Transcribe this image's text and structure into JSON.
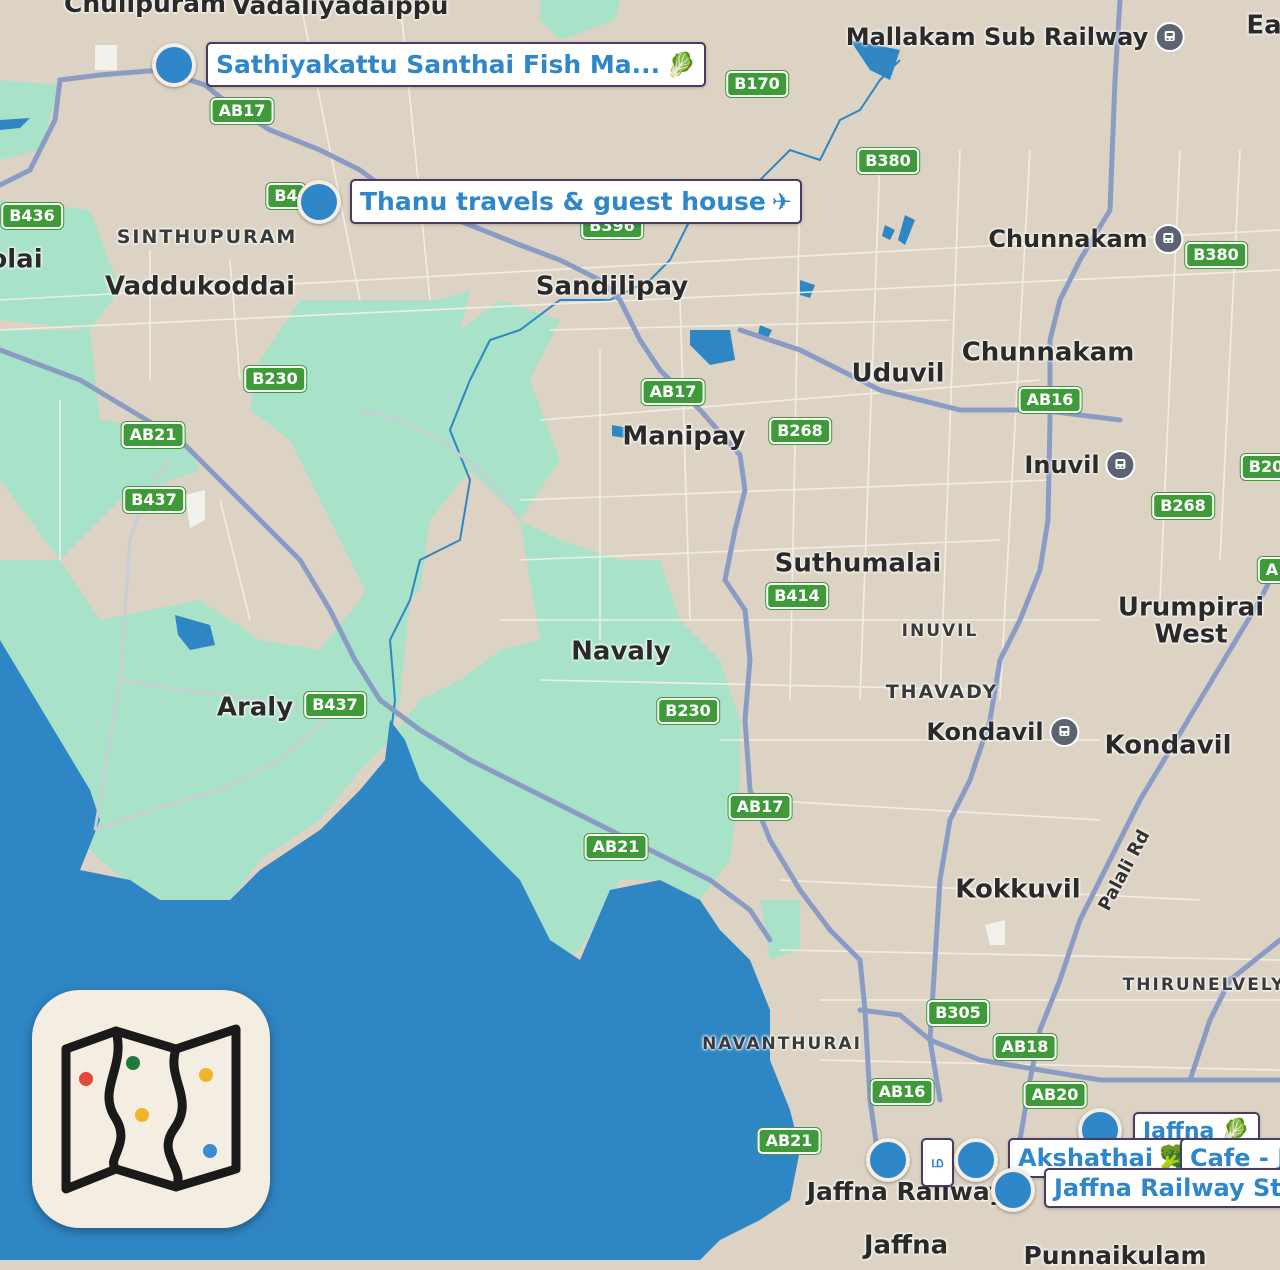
{
  "map": {
    "colors": {
      "land": "#dcd3c4",
      "water": "#2f86c4",
      "green": "#a8e2c8",
      "major_road": "#8b9cc4",
      "minor_road": "#f5f0e8",
      "route_shield": "#3f9a3a",
      "pin": "#2f86c9"
    },
    "places": [
      {
        "id": "chulipuram",
        "label": "Chulipuram"
      },
      {
        "id": "vadaliyadaippu",
        "label": "Vadaliyadaippu"
      },
      {
        "id": "sinthupuram",
        "label": "SINTHUPURAM"
      },
      {
        "id": "vaddukoddai",
        "label": "Vaddukoddai"
      },
      {
        "id": "olai",
        "label": "olai"
      },
      {
        "id": "sandilipay",
        "label": "Sandilipay"
      },
      {
        "id": "uduvil",
        "label": "Uduvil"
      },
      {
        "id": "chunnakam",
        "label": "Chunnakam"
      },
      {
        "id": "manipay",
        "label": "Manipay"
      },
      {
        "id": "suthumalai",
        "label": "Suthumalai"
      },
      {
        "id": "navaly",
        "label": "Navaly"
      },
      {
        "id": "inuvil_caps",
        "label": "INUVIL"
      },
      {
        "id": "urumpirai_west",
        "label": "Urumpirai West"
      },
      {
        "id": "thavady",
        "label": "THAVADY"
      },
      {
        "id": "kondavil",
        "label": "Kondavil"
      },
      {
        "id": "araly",
        "label": "Araly"
      },
      {
        "id": "kokkuvil",
        "label": "Kokkuvil"
      },
      {
        "id": "thirunelvely",
        "label": "THIRUNELVELY"
      },
      {
        "id": "navanthurai",
        "label": "NAVANTHURAI"
      },
      {
        "id": "jaffna",
        "label": "Jaffna"
      },
      {
        "id": "jaffna_railway_label",
        "label": "Jaffna Railway"
      },
      {
        "id": "ea",
        "label": "Ea"
      },
      {
        "id": "punnaikulam",
        "label": "Punnaikulam"
      }
    ],
    "rail_stations": [
      {
        "id": "mallakam",
        "label": "Mallakam Sub Railway"
      },
      {
        "id": "chunnakam_rail",
        "label": "Chunnakam"
      },
      {
        "id": "inuvil_rail",
        "label": "Inuvil"
      },
      {
        "id": "kondavil_rail",
        "label": "Kondavil"
      }
    ],
    "road_label": "Palali Rd",
    "routes": [
      "B170",
      "AB17",
      "B380",
      "B436",
      "B4",
      "B396",
      "B380",
      "B230",
      "AB17",
      "AB16",
      "AB21",
      "B268",
      "B20",
      "B437",
      "B268",
      "B414",
      "A",
      "B437",
      "B230",
      "AB17",
      "AB21",
      "B305",
      "AB18",
      "AB16",
      "AB20",
      "AB21"
    ],
    "pins": [
      {
        "label": "Sathiyakattu Santhai Fish Ma...",
        "icon": "vegetable-icon",
        "emoji": "🥬"
      },
      {
        "label": "Thanu travels & guest house",
        "icon": "airplane-icon",
        "emoji": "✈"
      },
      {
        "label": "Jaffna",
        "icon": "vegetable-icon",
        "emoji": "🥬"
      },
      {
        "label": "Akshathai",
        "icon": "broccoli-icon",
        "emoji": "🥦"
      },
      {
        "label": "Cafe - J",
        "icon": "",
        "emoji": ""
      },
      {
        "label": "Jaffna Railway Stati",
        "icon": "",
        "emoji": ""
      },
      {
        "label": "ம",
        "icon": "",
        "emoji": ""
      }
    ]
  },
  "app_icon": {
    "icon": "map-app-icon",
    "pin_colors": [
      "#e04a3a",
      "#1d7a3a",
      "#f0b629",
      "#f0b629",
      "#3a8bd0"
    ]
  }
}
